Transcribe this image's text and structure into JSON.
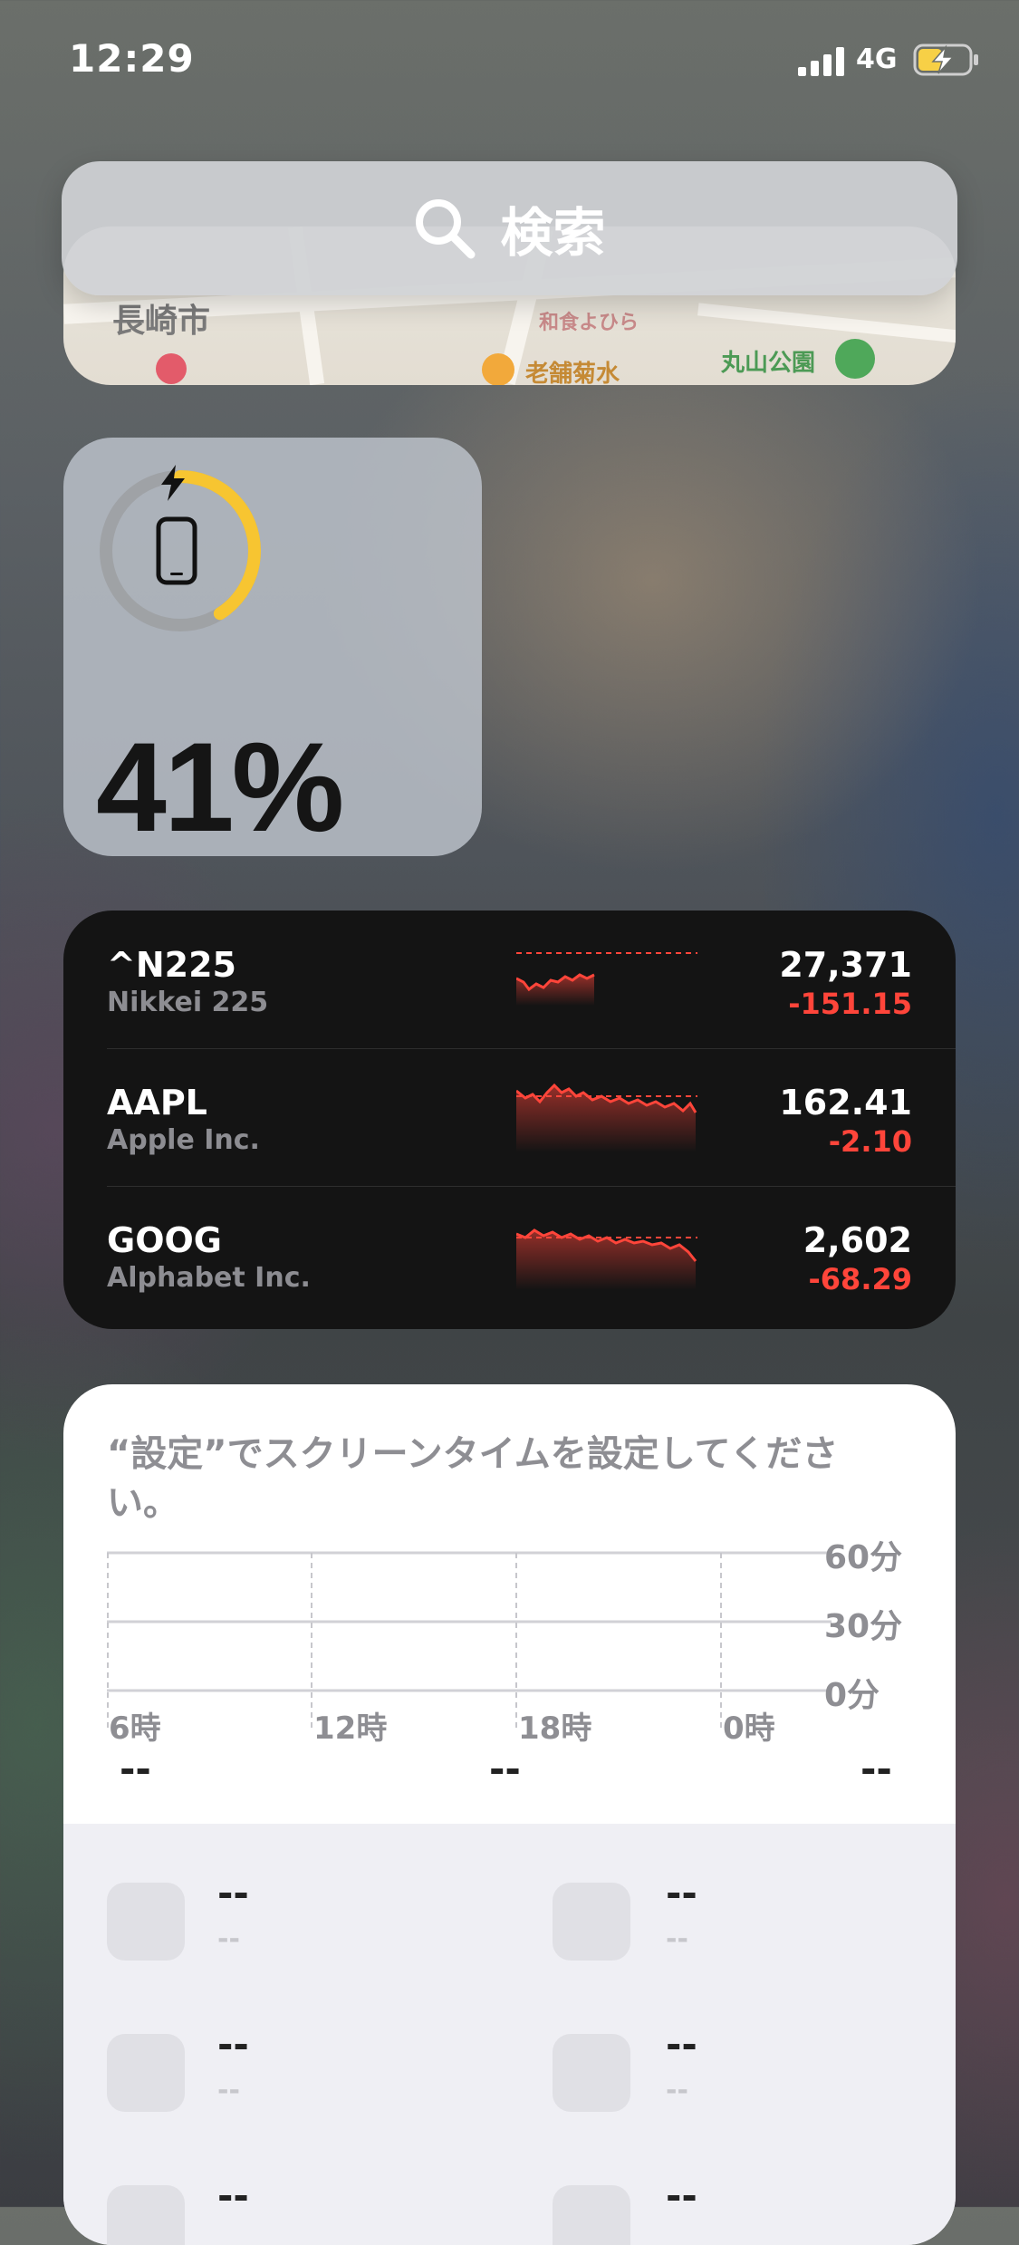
{
  "status_bar": {
    "time": "12:29",
    "network": "4G",
    "battery_charging": true
  },
  "map_widget": {
    "labels": [
      "長崎市",
      "老舗菊水",
      "丸山公園",
      "和食よひら"
    ]
  },
  "search": {
    "label": "検索",
    "icon": "search-icon"
  },
  "battery_widget": {
    "percent_label": "41%",
    "level": 0.41,
    "charging_icon": "bolt-icon",
    "device_icon": "iphone-icon",
    "ring_color": "#f7c531"
  },
  "stocks": {
    "accent_color": "#ff453a",
    "items": [
      {
        "symbol": "^N225",
        "name": "Nikkei 225",
        "price": "27,371",
        "change": "-151.15"
      },
      {
        "symbol": "AAPL",
        "name": "Apple Inc.",
        "price": "162.41",
        "change": "-2.10"
      },
      {
        "symbol": "GOOG",
        "name": "Alphabet Inc.",
        "price": "2,602",
        "change": "-68.29"
      }
    ]
  },
  "screen_time": {
    "message": "“設定”でスクリーンタイムを設定してください。",
    "y_labels": [
      "60分",
      "30分",
      "0分"
    ],
    "x_labels": [
      "6時",
      "12時",
      "18時",
      "0時"
    ],
    "summary": [
      "--",
      "--",
      "--"
    ],
    "apps": [
      {
        "name": "--",
        "time": "--"
      },
      {
        "name": "--",
        "time": "--"
      },
      {
        "name": "--",
        "time": "--"
      },
      {
        "name": "--",
        "time": "--"
      },
      {
        "name": "--",
        "time": "--"
      },
      {
        "name": "--",
        "time": "--"
      }
    ]
  }
}
